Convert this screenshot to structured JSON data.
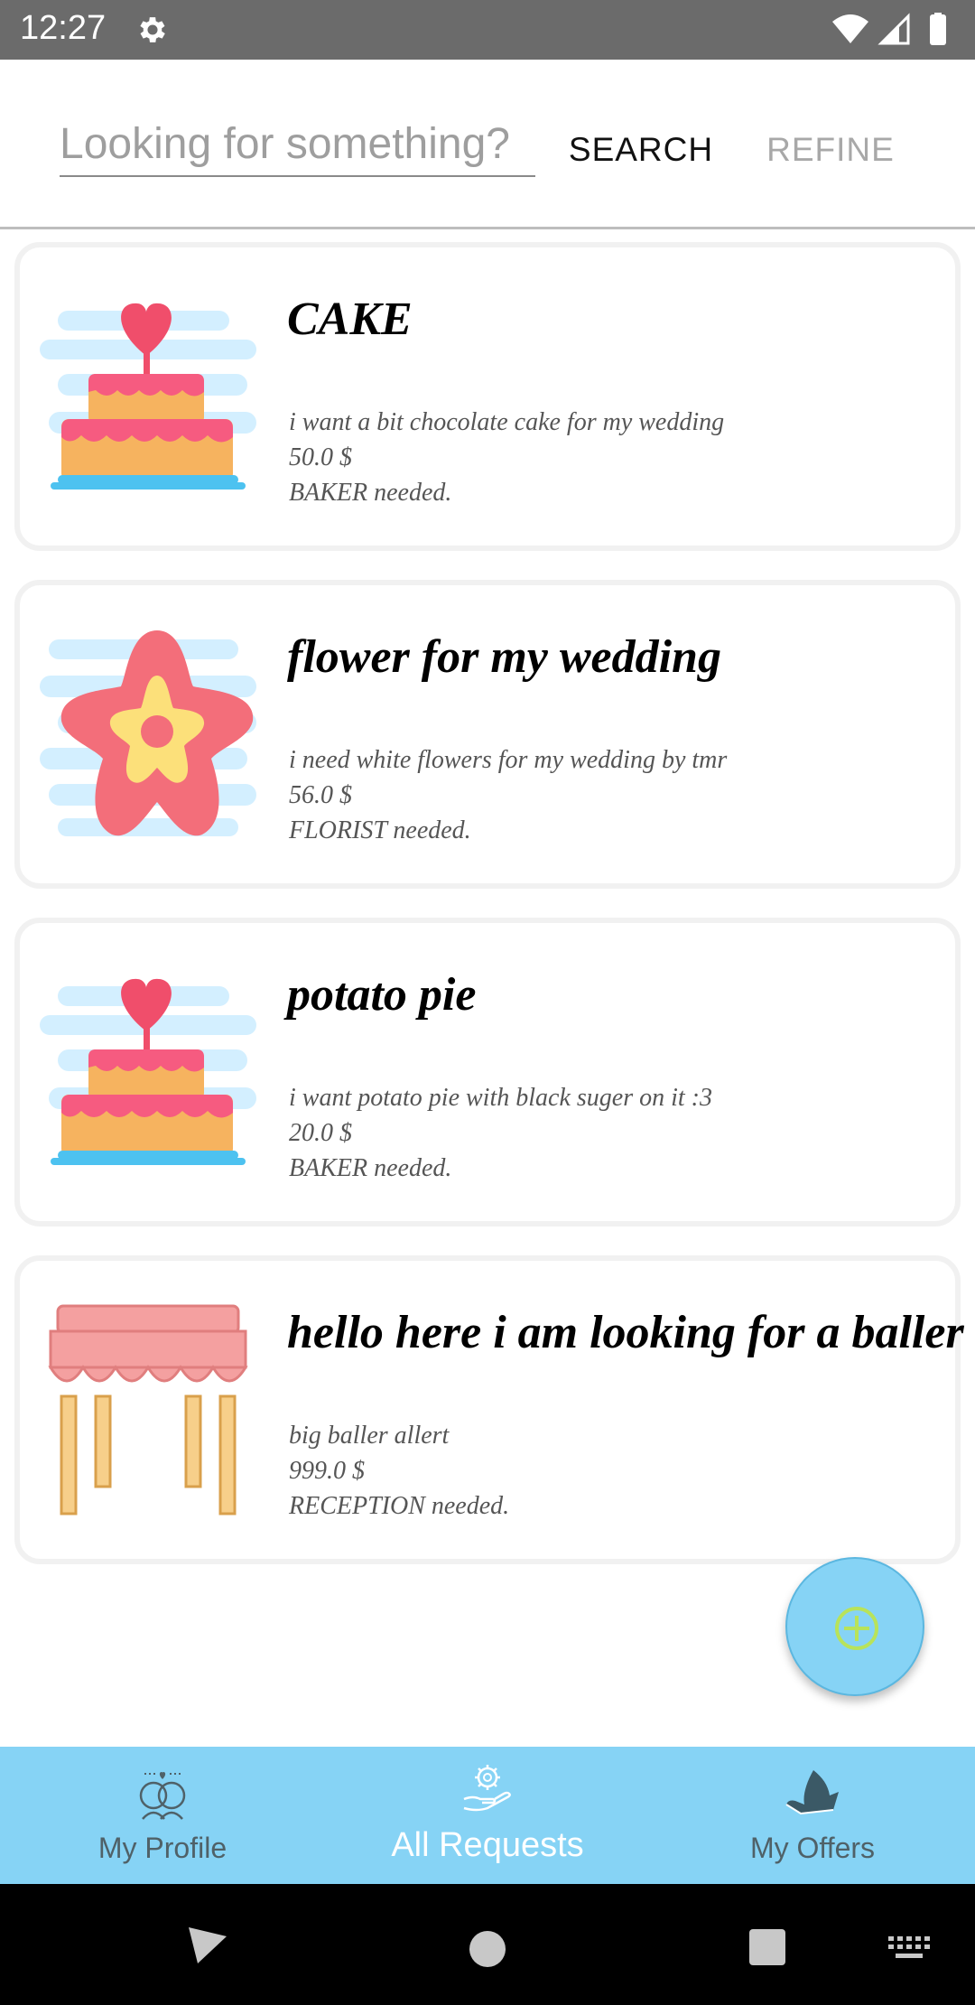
{
  "status_bar": {
    "time": "12:27"
  },
  "search": {
    "placeholder": "Looking for something?",
    "value": "",
    "search_label": "SEARCH",
    "refine_label": "REFINE"
  },
  "requests": [
    {
      "title": "CAKE",
      "description": "i want a bit chocolate  cake for my wedding",
      "price": "50.0 $",
      "role": "BAKER needed.",
      "icon": "cake-icon"
    },
    {
      "title": "flower for my wedding",
      "description": "i need white flowers for my wedding by tmr",
      "price": "56.0 $",
      "role": "FLORIST needed.",
      "icon": "flower-icon"
    },
    {
      "title": "potato pie",
      "description": "i want potato pie with black suger on it :3",
      "price": "20.0 $",
      "role": "BAKER needed.",
      "icon": "cake-icon"
    },
    {
      "title": "hello here i am looking for a baller",
      "description": "big baller allert",
      "price": "999.0 $",
      "role": "RECEPTION needed.",
      "icon": "canopy-icon"
    }
  ],
  "bottom_nav": {
    "items": [
      {
        "label": "My Profile",
        "icon": "couple-icon",
        "active": false
      },
      {
        "label": "All Requests",
        "icon": "gear-hand-icon",
        "active": true
      },
      {
        "label": "My Offers",
        "icon": "hand-offer-icon",
        "active": false
      }
    ]
  },
  "colors": {
    "accent": "#86d3f5",
    "status_bar": "#6b6b6b",
    "nav_label": "#4f6168"
  }
}
